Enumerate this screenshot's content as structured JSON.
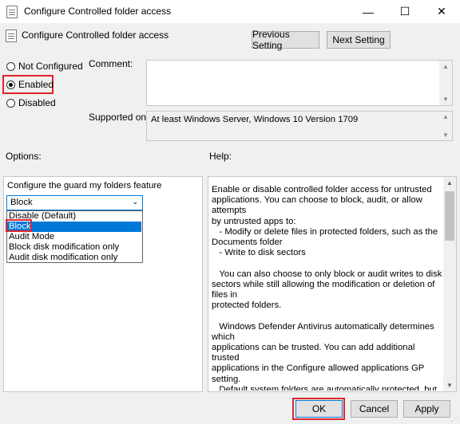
{
  "window": {
    "title": "Configure Controlled folder access",
    "minimize_glyph": "—",
    "maximize_glyph": "☐",
    "close_glyph": "✕"
  },
  "header": {
    "policy_name": "Configure Controlled folder access",
    "previous_setting": "Previous Setting",
    "next_setting": "Next Setting"
  },
  "state": {
    "not_configured": "Not Configured",
    "enabled": "Enabled",
    "disabled": "Disabled",
    "selected": "enabled"
  },
  "comment": {
    "label": "Comment:",
    "value": ""
  },
  "supported_on": {
    "label": "Supported on:",
    "value": "At least Windows Server, Windows 10 Version 1709"
  },
  "options": {
    "label": "Options:",
    "feature_label": "Configure the guard my folders feature",
    "selected_value": "Block",
    "items": [
      "Disable (Default)",
      "Block",
      "Audit Mode",
      "Block disk modification only",
      "Audit disk modification only"
    ]
  },
  "help": {
    "label": "Help:",
    "text": "Enable or disable controlled folder access for untrusted\napplications. You can choose to block, audit, or allow attempts\nby untrusted apps to:\n   - Modify or delete files in protected folders, such as the\nDocuments folder\n   - Write to disk sectors\n\n   You can also choose to only block or audit writes to disk\nsectors while still allowing the modification or deletion of files in\nprotected folders.\n\n   Windows Defender Antivirus automatically determines which\napplications can be trusted. You can add additional trusted\napplications in the Configure allowed applications GP setting.\n   Default system folders are automatically protected, but you\ncan add folders in the Configure protected folders GP setting.\n\n   Block:\n   The following will be blocked:\n   - Attempts by untrusted apps to modify or delete files in"
  },
  "footer": {
    "ok": "OK",
    "cancel": "Cancel",
    "apply": "Apply"
  }
}
